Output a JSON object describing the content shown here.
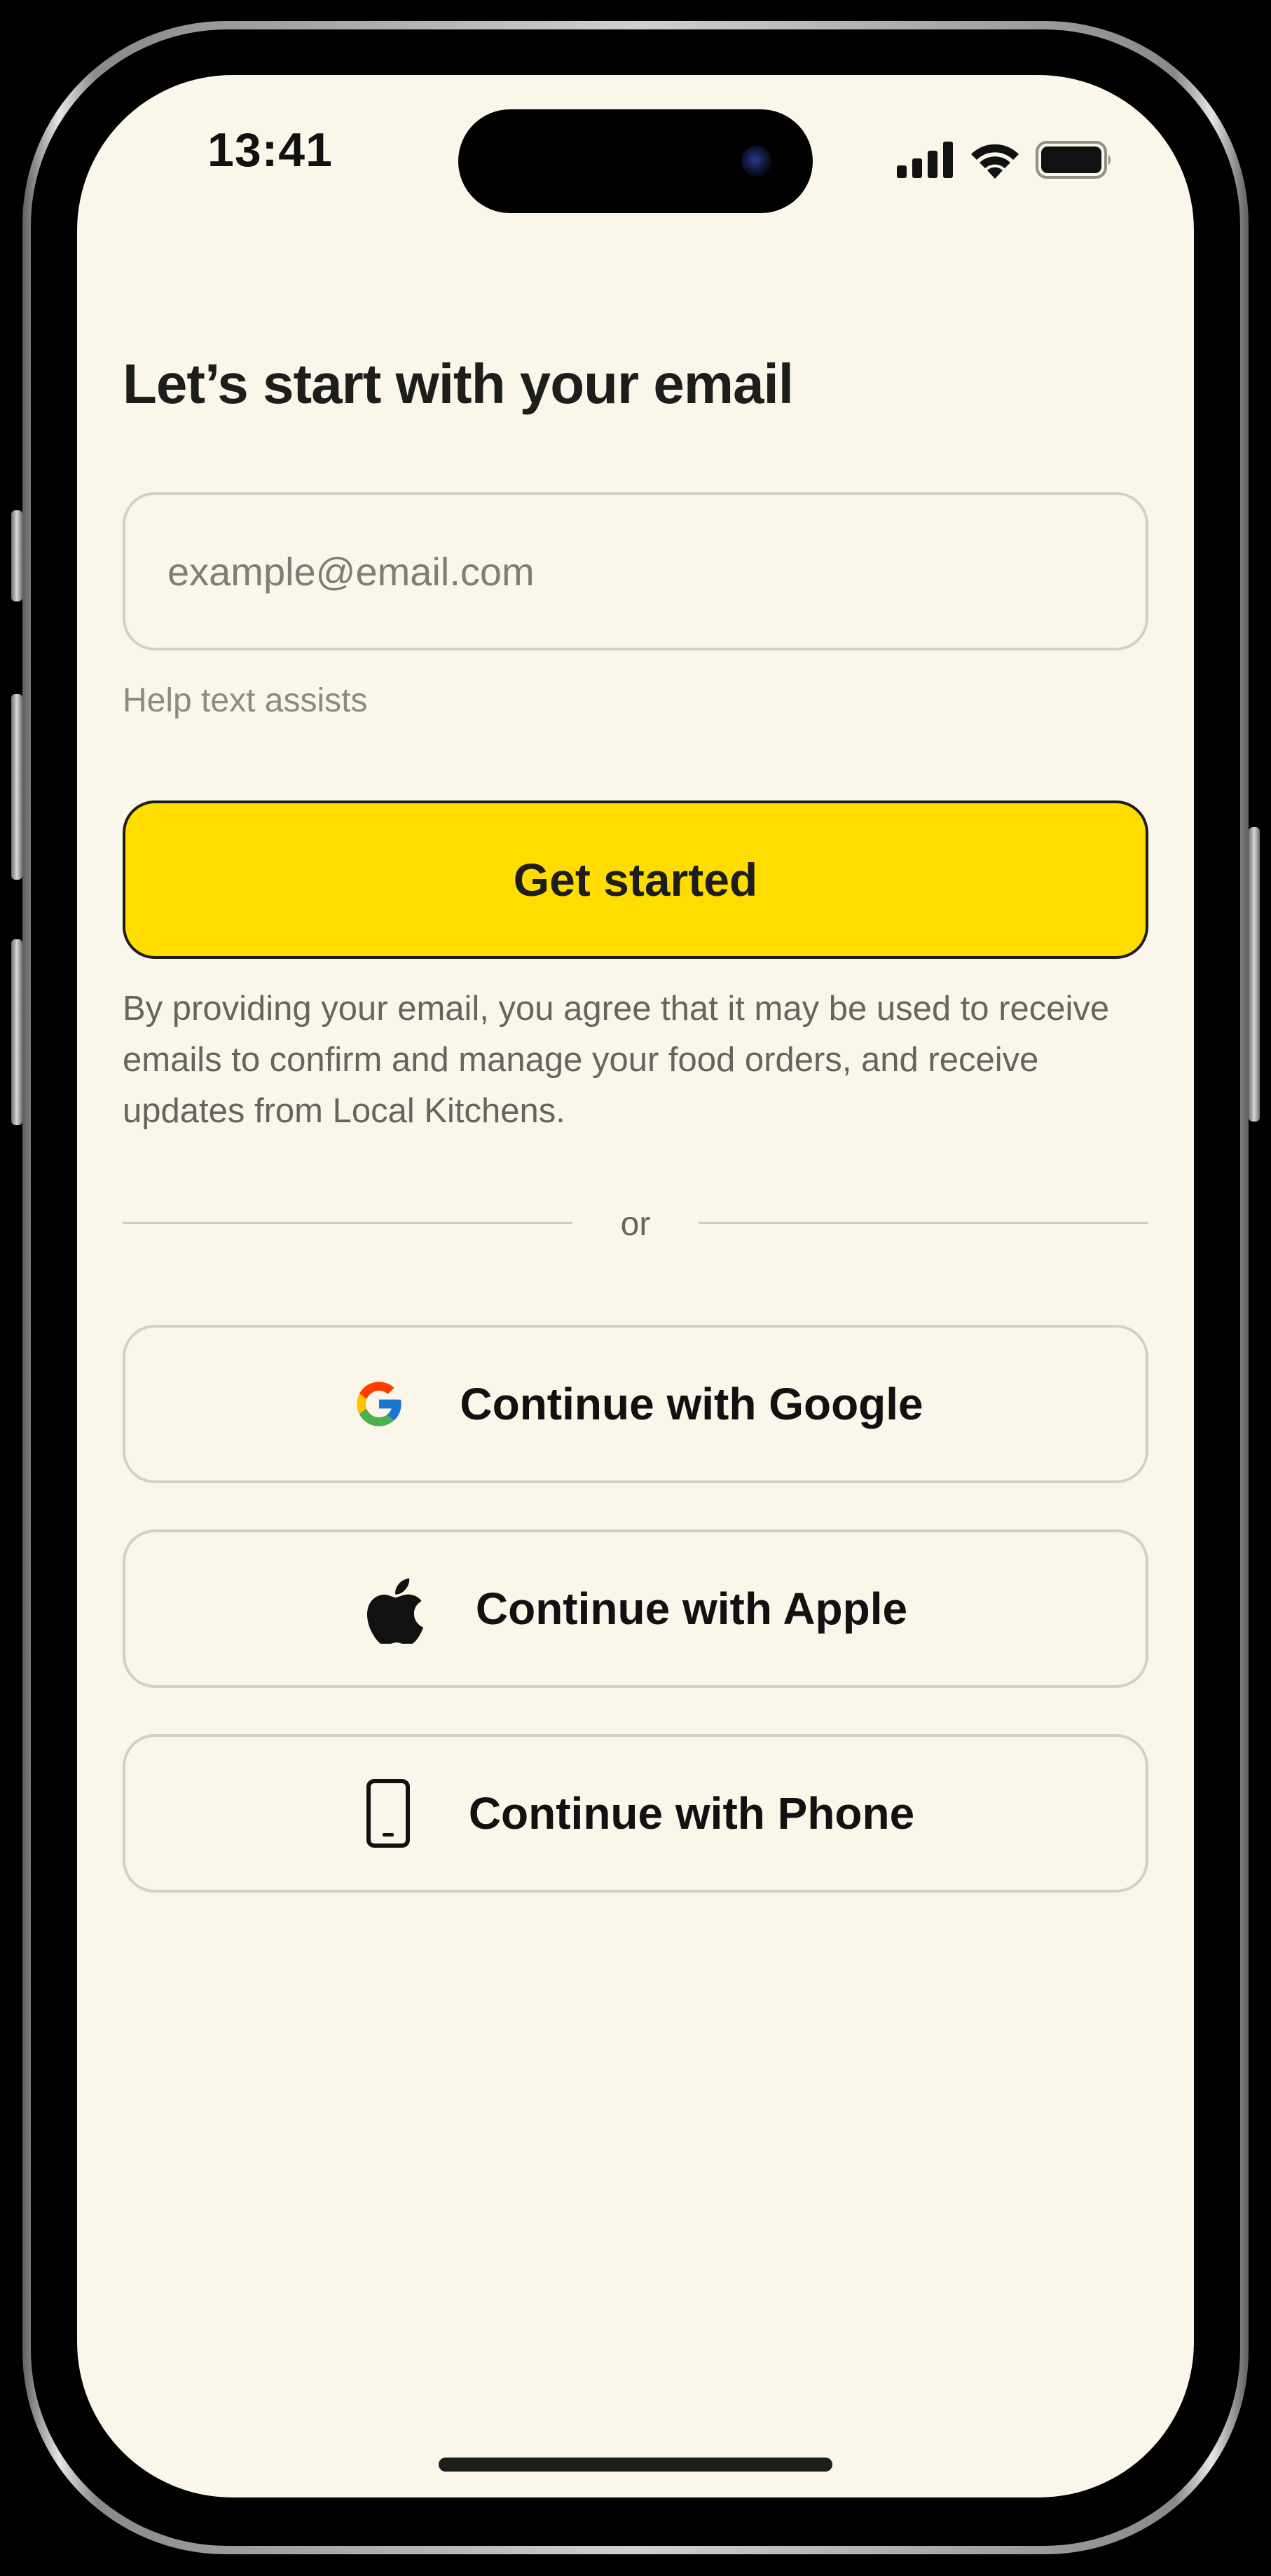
{
  "status_bar": {
    "time": "13:41",
    "signal_icon": "cellular-signal-icon",
    "wifi_icon": "wifi-icon",
    "battery_icon": "battery-icon"
  },
  "header": {
    "title": "Let’s start with your email"
  },
  "email_field": {
    "value": "",
    "placeholder": "example@email.com",
    "help_text": "Help text assists"
  },
  "primary_action": {
    "label": "Get started"
  },
  "disclaimer": "By providing your email, you agree that it may be used to receive emails to confirm and manage your food orders, and receive updates from Local Kitchens.",
  "divider": {
    "label": "or"
  },
  "social_buttons": [
    {
      "label": "Continue with Google",
      "icon": "google-icon"
    },
    {
      "label": "Continue with Apple",
      "icon": "apple-icon"
    },
    {
      "label": "Continue with Phone",
      "icon": "phone-icon"
    }
  ],
  "colors": {
    "background": "#faf6ea",
    "accent": "#ffdd00",
    "text": "#1d1d1b",
    "muted_text": "#8c8a82",
    "border": "#d4d0c2"
  }
}
